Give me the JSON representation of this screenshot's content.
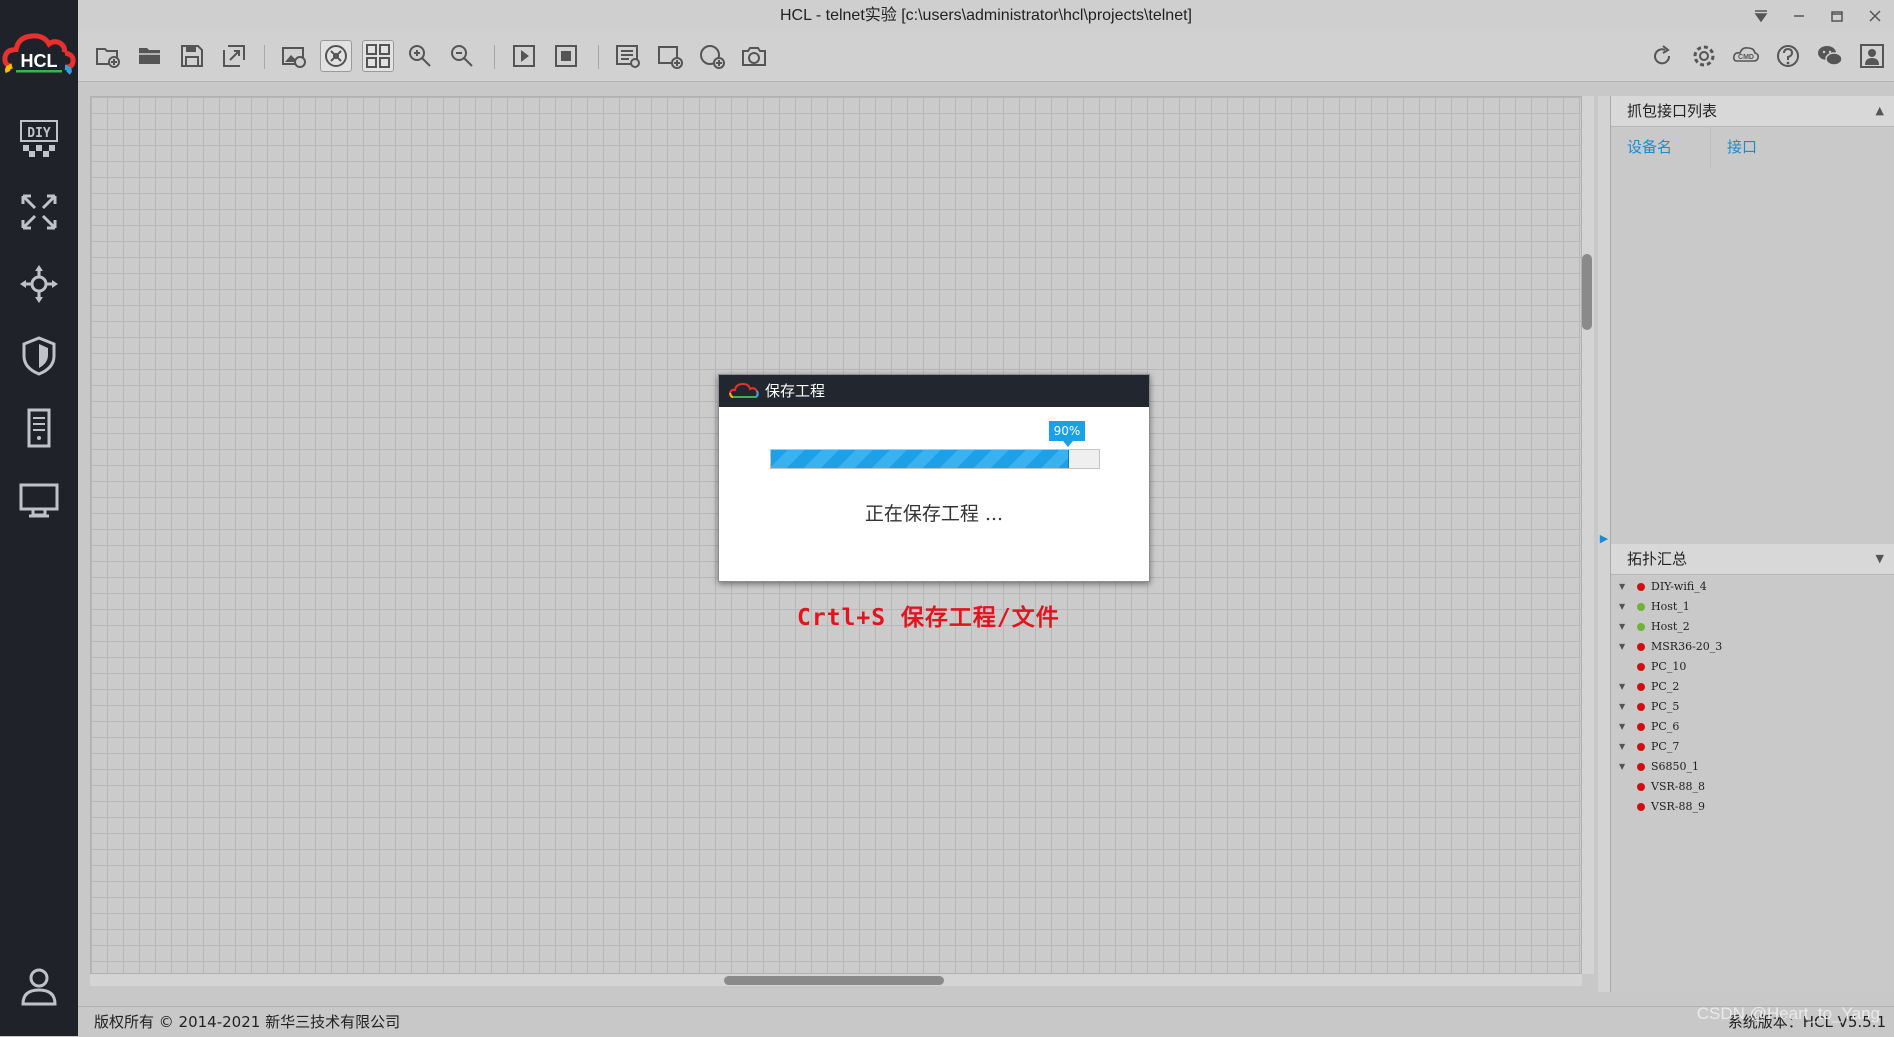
{
  "window": {
    "title": "HCL - telnet实验 [c:\\users\\administrator\\hcl\\projects\\telnet]",
    "brand": "HCL"
  },
  "sidebar": {
    "items": [
      {
        "icon": "diy-icon",
        "label": "DIY"
      },
      {
        "icon": "router-icon"
      },
      {
        "icon": "switch-move-icon"
      },
      {
        "icon": "shield-icon"
      },
      {
        "icon": "server-icon"
      },
      {
        "icon": "monitor-icon"
      }
    ],
    "bottom_icon": "user-icon"
  },
  "toolbar": {
    "left_icons": [
      "new-project-icon",
      "open-folder-icon",
      "save-icon",
      "save-as-icon",
      "screenshot-icon",
      "grid-link-icon",
      "layout-icon",
      "zoom-in-icon",
      "zoom-out-icon",
      "start-icon",
      "stop-icon",
      "text-note-icon",
      "add-rect-icon",
      "add-ellipse-icon",
      "camera-icon"
    ],
    "right_icons": [
      "refresh-icon",
      "settings-icon",
      "cmd-icon",
      "help-icon",
      "wechat-icon",
      "user-info-icon"
    ],
    "cmd_label": "CMD"
  },
  "capture_panel": {
    "title": "抓包接口列表",
    "col_device": "设备名",
    "col_interface": "接口"
  },
  "topology_panel": {
    "title": "拓扑汇总",
    "items": [
      {
        "name": "DIY-wifi_4",
        "status": "red",
        "expandable": true
      },
      {
        "name": "Host_1",
        "status": "green",
        "expandable": true
      },
      {
        "name": "Host_2",
        "status": "green",
        "expandable": true
      },
      {
        "name": "MSR36-20_3",
        "status": "red",
        "expandable": true
      },
      {
        "name": "PC_10",
        "status": "red",
        "expandable": false
      },
      {
        "name": "PC_2",
        "status": "red",
        "expandable": true
      },
      {
        "name": "PC_5",
        "status": "red",
        "expandable": true
      },
      {
        "name": "PC_6",
        "status": "red",
        "expandable": true
      },
      {
        "name": "PC_7",
        "status": "red",
        "expandable": true
      },
      {
        "name": "S6850_1",
        "status": "red",
        "expandable": true
      },
      {
        "name": "VSR-88_8",
        "status": "red",
        "expandable": false
      },
      {
        "name": "VSR-88_9",
        "status": "red",
        "expandable": false
      }
    ]
  },
  "dialog": {
    "title": "保存工程",
    "progress": 0.9,
    "progress_label": "90%",
    "message": "正在保存工程 ..."
  },
  "annotation": "Crtl+S 保存工程/文件",
  "statusbar": {
    "copyright": "版权所有 © 2014-2021 新华三技术有限公司",
    "version": "系统版本：HCL V5.5.1"
  },
  "watermark": "CSDN @Heart_to_Yang",
  "colors": {
    "accent": "#1a8ccf",
    "status_red": "#d01010",
    "status_green": "#6fb33a",
    "annotation": "#e0151f"
  }
}
